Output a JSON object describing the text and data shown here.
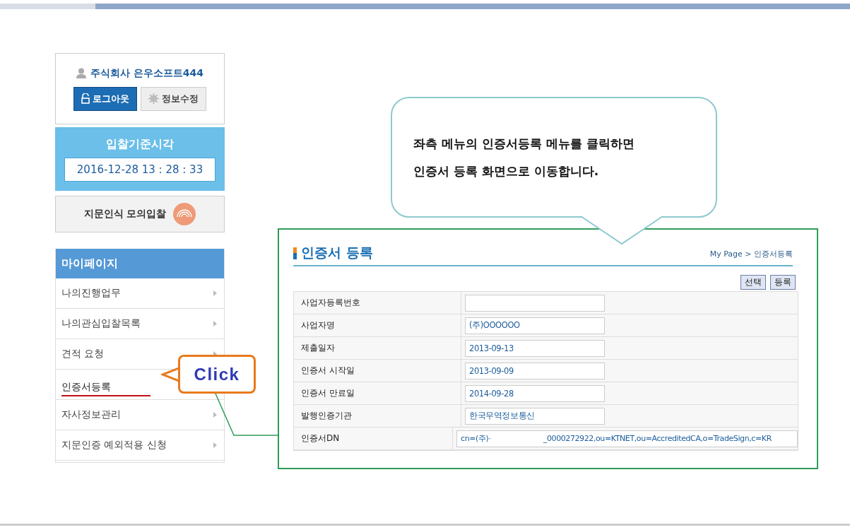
{
  "user_box": {
    "company": "주식회사 은우소프트444",
    "buttons": [
      {
        "kind": "primary",
        "label": "로그아웃"
      },
      {
        "kind": "secondary",
        "label": "정보수정"
      }
    ]
  },
  "clock": {
    "title": "입찰기준시각",
    "time": "2016-12-28 13 : 28 : 33"
  },
  "fingerprint_button": {
    "label": "지문인식 모의입찰"
  },
  "sidebar": {
    "title": "마이페이지",
    "items": [
      {
        "label": "나의진행업무",
        "selected": false
      },
      {
        "label": "나의관심입찰목록",
        "selected": false
      },
      {
        "label": "견적 요청",
        "selected": false
      },
      {
        "label": "인증서등록",
        "selected": true
      },
      {
        "label": "자사정보관리",
        "selected": false
      },
      {
        "label": "지문인증 예외적용 신청",
        "selected": false
      }
    ]
  },
  "callout": {
    "lines": [
      "좌측 메뉴의 인증서등록 메뉴를 클릭하면",
      "인증서 등록 화면으로 이동합니다."
    ]
  },
  "click_label": "Click",
  "panel": {
    "title": "인증서 등록",
    "breadcrumb": "My Page > 인증서등록",
    "buttons": [
      "선택",
      "등록"
    ],
    "rows": [
      {
        "label": "사업자등록번호"
      },
      {
        "label": "사업자명",
        "value": "(주)OOOOOO"
      },
      {
        "label": "제출일자",
        "value": "2013-09-13"
      },
      {
        "label": "인증서 시작일",
        "value": "2013-09-09"
      },
      {
        "label": "인증서 만료일",
        "value": "2014-09-28"
      },
      {
        "label": "발행인증기관",
        "value": "한국무역정보통신"
      },
      {
        "label": "인증서DN",
        "value": "cn=(주)·                        _0000272922,ou=KTNET,ou=AccreditedCA,o=TradeSign,c=KR",
        "wide": true
      }
    ]
  }
}
